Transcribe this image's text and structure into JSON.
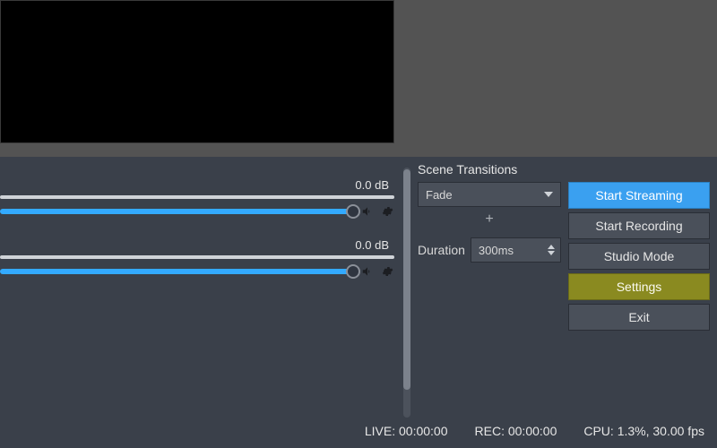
{
  "mixer": {
    "channels": [
      {
        "db": "0.0 dB"
      },
      {
        "db": "0.0 dB"
      }
    ]
  },
  "transitions": {
    "title": "Scene Transitions",
    "selected": "Fade",
    "duration_label": "Duration",
    "duration_value": "300ms"
  },
  "controls": {
    "start_streaming": "Start Streaming",
    "start_recording": "Start Recording",
    "studio_mode": "Studio Mode",
    "settings": "Settings",
    "exit": "Exit"
  },
  "status": {
    "live": "LIVE: 00:00:00",
    "rec": "REC: 00:00:00",
    "cpu": "CPU: 1.3%, 30.00 fps"
  }
}
